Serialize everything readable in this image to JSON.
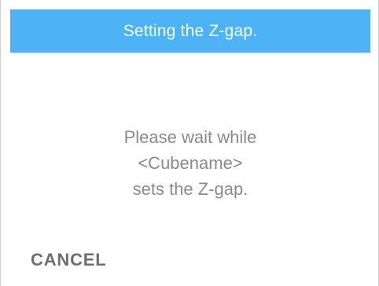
{
  "dialog": {
    "title": "Setting the Z-gap.",
    "message_lines": [
      "Please wait while",
      "<Cubename>",
      "sets the Z-gap."
    ],
    "cancel_label": "CANCEL"
  },
  "colors": {
    "header_background": "#4db3f5",
    "header_text": "#ffffff",
    "message_text": "#8a8a8a",
    "cancel_text": "#6e6e6e"
  }
}
